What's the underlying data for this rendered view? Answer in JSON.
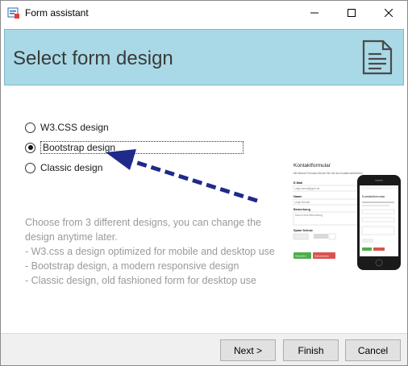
{
  "window": {
    "title": "Form assistant"
  },
  "header": {
    "title": "Select form design"
  },
  "options": [
    {
      "label": "W3.CSS design",
      "selected": false
    },
    {
      "label": "Bootstrap design",
      "selected": true
    },
    {
      "label": "Classic design",
      "selected": false
    }
  ],
  "description": {
    "lines": [
      "Choose from 3 different designs, you can change the design anytime later.",
      "- W3.css a design optimized for mobile and desktop use",
      "- Bootstrap design, a modern responsive design",
      "- Classic design, old fashioned form for desktop use"
    ]
  },
  "preview": {
    "form_title": "Kontaktformular",
    "intro": "Mit diesem Formular können Sie mit uns Kontakt aufnehmen",
    "fields": [
      "E-Mail",
      "Name",
      "Bemerkung"
    ],
    "email_value": "antje.bemat@gmx.de",
    "name_value": "Antje Bender",
    "remark_value": "Das ist eine Bemerkung",
    "spam_label": "Spam Schutz",
    "buttons": [
      "Absenden",
      "Zurücksetzen"
    ],
    "phone_title": "Kontaktformular"
  },
  "buttons": {
    "next": "Next >",
    "finish": "Finish",
    "cancel": "Cancel"
  },
  "colors": {
    "header_bg": "#a9d9e6",
    "arrow": "#1f2a8a",
    "description_text": "#9a9a9a"
  }
}
